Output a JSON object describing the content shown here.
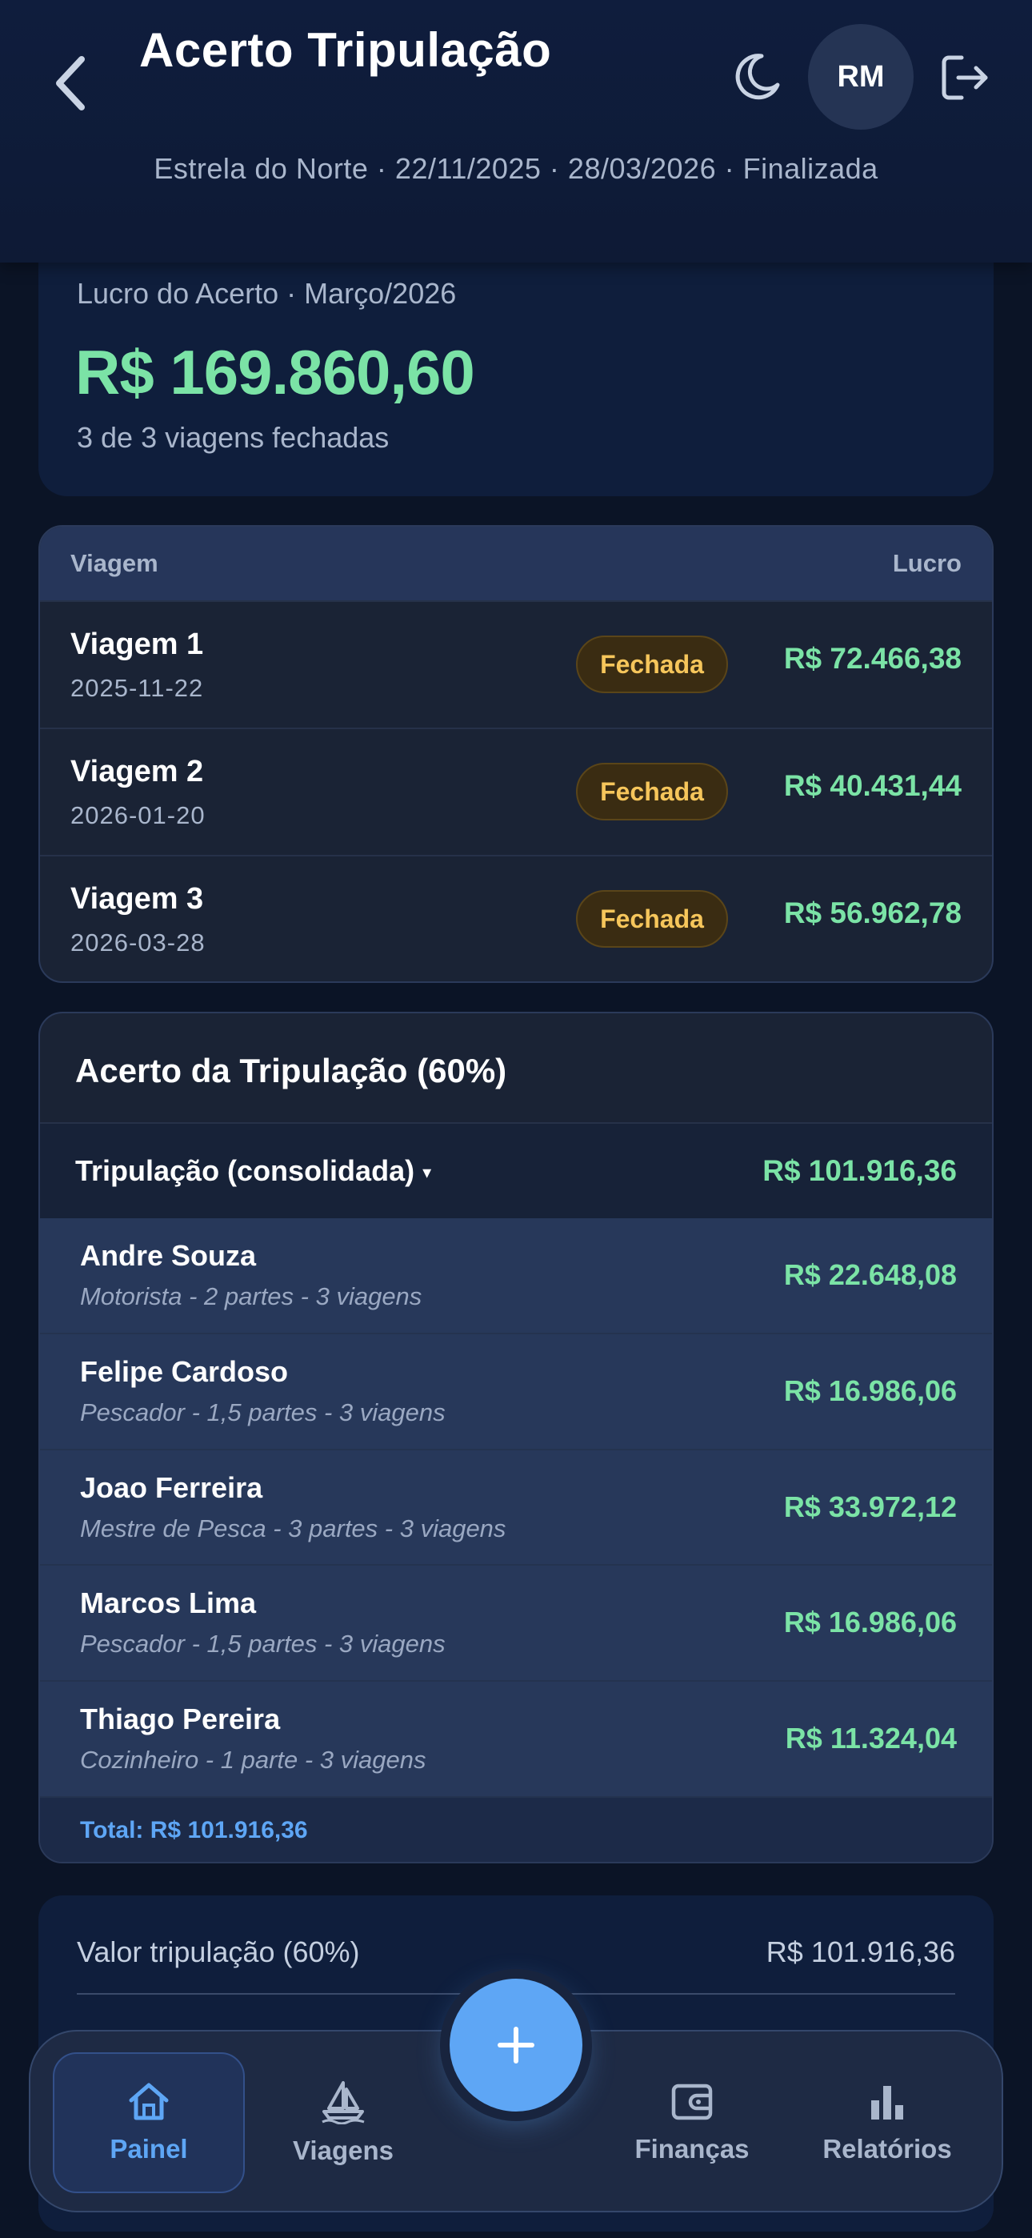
{
  "header": {
    "title": "Acerto Tripulação",
    "avatar_initials": "RM",
    "subtitle": "Estrela do Norte · 22/11/2025 · 28/03/2026 · Finalizada"
  },
  "summary": {
    "label": "Lucro do Acerto · Março/2026",
    "value": "R$ 169.860,60",
    "sub": "3 de 3 viagens fechadas"
  },
  "trips": {
    "col_trip": "Viagem",
    "col_profit": "Lucro",
    "rows": [
      {
        "name": "Viagem 1",
        "date": "2025-11-22",
        "status": "Fechada",
        "profit": "R$ 72.466,38"
      },
      {
        "name": "Viagem 2",
        "date": "2026-01-20",
        "status": "Fechada",
        "profit": "R$ 40.431,44"
      },
      {
        "name": "Viagem 3",
        "date": "2026-03-28",
        "status": "Fechada",
        "profit": "R$ 56.962,78"
      }
    ]
  },
  "crew": {
    "title": "Acerto da Tripulação (60%)",
    "consolidated_label": "Tripulação (consolidada)",
    "consolidated_arrow": "▾",
    "consolidated_value": "R$ 101.916,36",
    "members": [
      {
        "name": "Andre Souza",
        "desc": "Motorista - 2 partes - 3 viagens",
        "value": "R$ 22.648,08"
      },
      {
        "name": "Felipe Cardoso",
        "desc": "Pescador - 1,5 partes - 3 viagens",
        "value": "R$ 16.986,06"
      },
      {
        "name": "Joao Ferreira",
        "desc": "Mestre de Pesca - 3 partes - 3 viagens",
        "value": "R$ 33.972,12"
      },
      {
        "name": "Marcos Lima",
        "desc": "Pescador - 1,5 partes - 3 viagens",
        "value": "R$ 16.986,06"
      },
      {
        "name": "Thiago Pereira",
        "desc": "Cozinheiro - 1 parte - 3 viagens",
        "value": "R$ 11.324,04"
      }
    ],
    "total": "Total: R$ 101.916,36"
  },
  "valores": {
    "label": "Valor tripulação (60%)",
    "value": "R$ 101.916,36"
  },
  "nav": {
    "items": [
      {
        "label": "Painel",
        "icon": "home-icon",
        "active": true
      },
      {
        "label": "Viagens",
        "icon": "sailboat-icon",
        "active": false
      },
      {
        "label": "Finanças",
        "icon": "wallet-icon",
        "active": false
      },
      {
        "label": "Relatórios",
        "icon": "bar-chart-icon",
        "active": false
      }
    ],
    "fab_icon": "plus-icon"
  },
  "colors": {
    "accent_green": "#7be3a6",
    "accent_blue": "#5ea6f5",
    "badge_yellow": "#f6c65b",
    "background": "#0b1426"
  }
}
